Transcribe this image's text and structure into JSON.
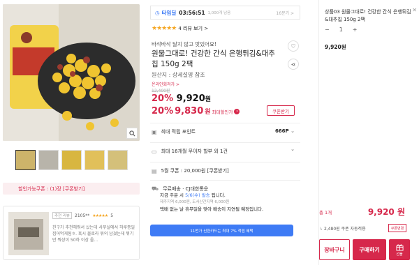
{
  "gallery": {
    "coupon_strip": "할인가능쿠폰 : (1)장 [쿠폰받기]"
  },
  "review": {
    "tag": "추천 리뷰",
    "user": "2105**",
    "stars": "★★★★★",
    "score": "5",
    "text": "친구가 추천해줘서 샀는데 사무실에서 허루종일 집어먹게됨ㅎ. 혹시 몰로라 묶의 남겼는데 뭐기만 뭐상이 50하 이상 올..."
  },
  "timedeal": {
    "label": "타임딜",
    "time": "03:56:51",
    "limit": "1,000개 남음",
    "remaining": "16분기 >"
  },
  "rating": {
    "stars": "★★★★★",
    "text": "4 리뷰 보기 >"
  },
  "product": {
    "subtitle": "바삭바삭 달지 않고 맛있어요!",
    "title": "원물그대로! 건강한 간식 은행튀김&대추칩 150g 2팩",
    "origin": "원산지 : 상세설명 참조",
    "online_label": "온라인회저가 >",
    "original_price": "12,400원",
    "discount1": "20%",
    "price1": "9,920",
    "price1_unit": "원",
    "discount2": "20%",
    "price2": "9,830",
    "price2_unit": "원",
    "max_label": "최대할인가",
    "coupon_button": "쿠폰받기"
  },
  "info": {
    "points_label": "최대 적립 포인트",
    "points_value": "666P",
    "installment": "최대 16개월 무이자 할부 외 1건",
    "coupon_row": "5월 쿠폰 : 20,000원 [쿠폰받기]"
  },
  "shipping": {
    "label": "무료배송 · CJ대한통운",
    "line1_prefix": "지금 주문 시",
    "line1_date": "5/6(수) 발송",
    "line1_suffix": "됩니다.",
    "line2": "제주지역 6,000원, 도서산간지역 6,000원",
    "line3": "택배 없는 날 휴무일을 맞아 배송이 지연될 예정입니다.",
    "blue_button": "11번가 신한카드는 최대 7% 적립 혜택"
  },
  "cart": {
    "item_title": "상품03 원물그대로! 건강한 간식 은행튀김&대추칩 150g 2팩",
    "qty": "1",
    "item_price": "9,920원",
    "total_label": "총 1개",
    "total_value": "9,920 원",
    "auto_label": "2,480원 쿠폰 자동적용",
    "auto_button": "쿠폰변경",
    "cart_button": "장바구니",
    "buy_button": "구매하기",
    "gift_button": "선물"
  },
  "colors": {
    "accent": "#d6284b",
    "blue": "#3e7bf5",
    "star": "#f5a623"
  }
}
